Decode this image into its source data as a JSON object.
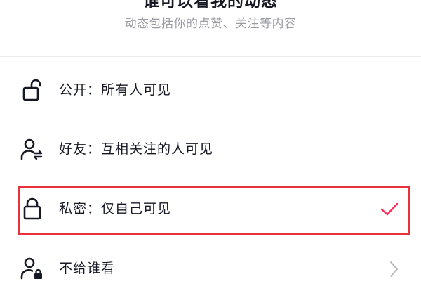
{
  "header": {
    "title": "谁可以看我的动态",
    "subtitle": "动态包括你的点赞、关注等内容"
  },
  "options": [
    {
      "label": "公开：所有人可见",
      "icon": "unlocked-padlock-icon",
      "selected": false
    },
    {
      "label": "好友：互相关注的人可见",
      "icon": "mutual-friends-icon",
      "selected": false
    },
    {
      "label": "私密：仅自己可见",
      "icon": "locked-padlock-icon",
      "selected": true
    },
    {
      "label": "不给谁看",
      "icon": "user-lock-icon",
      "selected": false
    }
  ],
  "colors": {
    "accent": "#fe2c55",
    "highlight_border": "#e8313a",
    "text": "#161823",
    "subtext": "#9a9ba1"
  }
}
